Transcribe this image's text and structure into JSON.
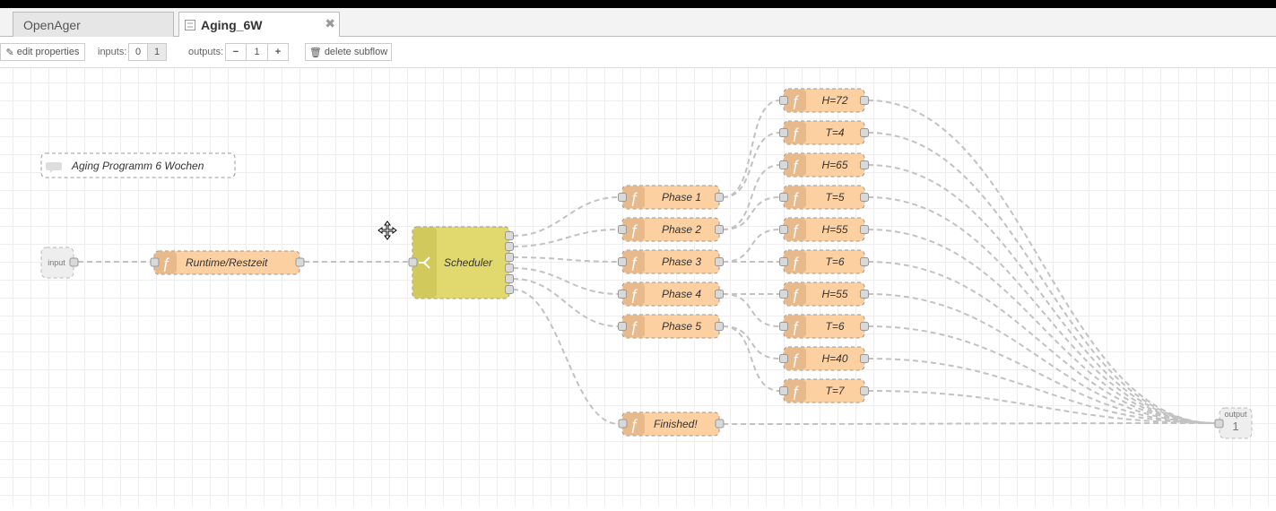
{
  "tabs": [
    {
      "label": "OpenAger",
      "active": false
    },
    {
      "label": "Aging_6W",
      "active": true
    }
  ],
  "toolbar": {
    "edit_label": "edit properties",
    "inputs_label": "inputs:",
    "inputs_options": [
      "0",
      "1"
    ],
    "outputs_label": "outputs:",
    "outputs_value": "1",
    "delete_label": "delete subflow"
  },
  "colors": {
    "function_node": "#fdd0a2",
    "switch_node": "#e2d96e",
    "wire": "#c2c2c2",
    "grid": "#eeeeee"
  },
  "flow": {
    "comment": "Aging Programm 6 Wochen",
    "input_label": "input",
    "output_label": "output",
    "output_number": "1",
    "runtime_label": "Runtime/Restzeit",
    "scheduler_label": "Scheduler",
    "phases": [
      "Phase 1",
      "Phase 2",
      "Phase 3",
      "Phase 4",
      "Phase 5"
    ],
    "settings": [
      "H=72",
      "T=4",
      "H=65",
      "T=5",
      "H=55",
      "T=6",
      "H=55",
      "T=6",
      "H=40",
      "T=7"
    ],
    "finished_label": "Finished!"
  }
}
